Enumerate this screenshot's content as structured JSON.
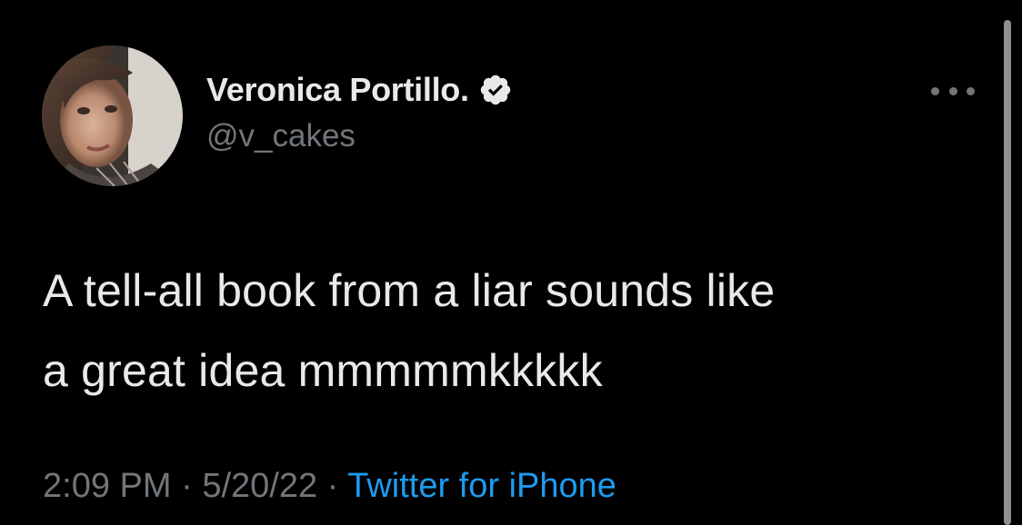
{
  "author": {
    "display_name": "Veronica Portillo.",
    "handle": "@v_cakes",
    "verified": true,
    "avatar_icon": "profile-photo"
  },
  "tweet": {
    "text_lines": [
      "A tell-all book from a liar sounds like",
      "a great idea mmmmmkkkkk"
    ]
  },
  "meta": {
    "time": "2:09 PM",
    "separator": " · ",
    "date": "5/20/22",
    "source": "Twitter for iPhone"
  },
  "icons": {
    "verified": "verified-badge-icon",
    "more": "more-options-icon"
  },
  "colors": {
    "background": "#000000",
    "text_primary": "#e7e9ea",
    "text_secondary": "#71767b",
    "link": "#1d9bf0",
    "verified_badge": "#e7e9ea"
  }
}
